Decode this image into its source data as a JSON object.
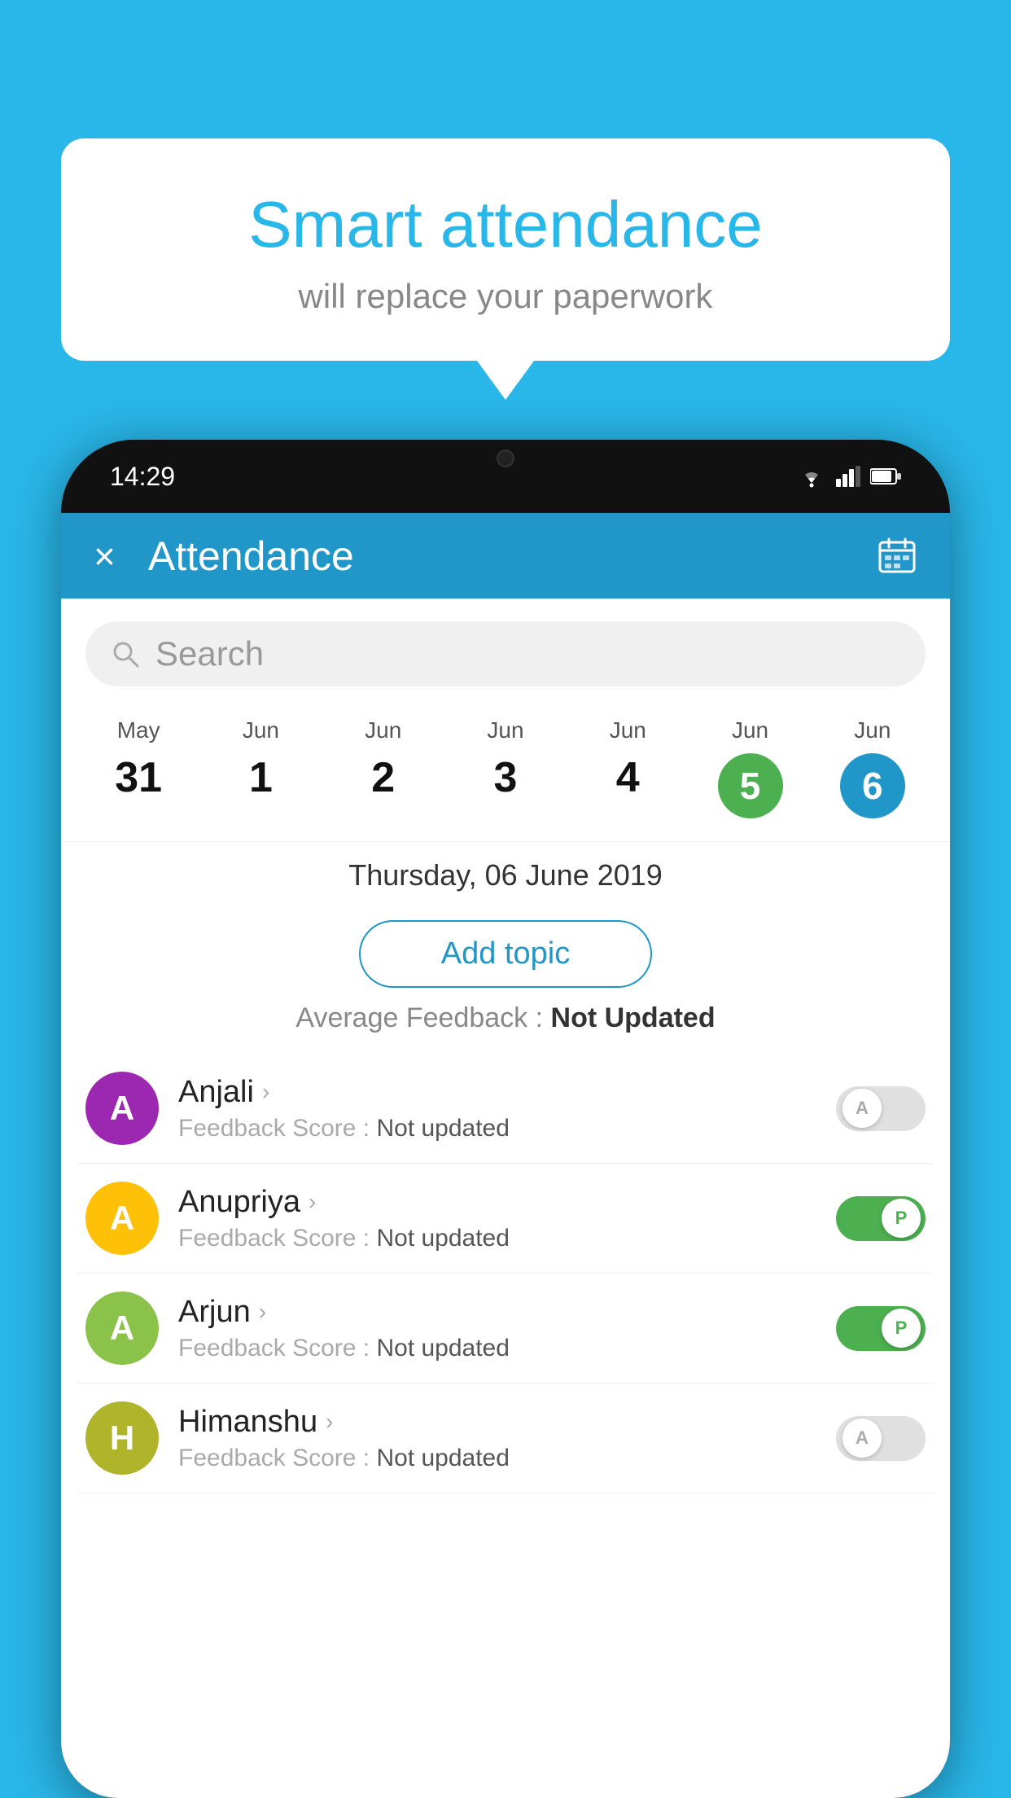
{
  "background": {
    "color": "#29b6e8"
  },
  "speech_bubble": {
    "title": "Smart attendance",
    "subtitle": "will replace your paperwork"
  },
  "phone": {
    "status_bar": {
      "time": "14:29",
      "icons": [
        "wifi",
        "signal",
        "battery"
      ]
    },
    "header": {
      "title": "Attendance",
      "close_label": "×",
      "calendar_icon": "📅"
    },
    "search": {
      "placeholder": "Search"
    },
    "dates": [
      {
        "month": "May",
        "number": "31",
        "state": "normal"
      },
      {
        "month": "Jun",
        "number": "1",
        "state": "normal"
      },
      {
        "month": "Jun",
        "number": "2",
        "state": "normal"
      },
      {
        "month": "Jun",
        "number": "3",
        "state": "normal"
      },
      {
        "month": "Jun",
        "number": "4",
        "state": "normal"
      },
      {
        "month": "Jun",
        "number": "5",
        "state": "active-green"
      },
      {
        "month": "Jun",
        "number": "6",
        "state": "active-blue"
      }
    ],
    "selected_date": "Thursday, 06 June 2019",
    "add_topic_label": "Add topic",
    "avg_feedback_label": "Average Feedback :",
    "avg_feedback_value": "Not Updated",
    "students": [
      {
        "name": "Anjali",
        "avatar_letter": "A",
        "avatar_color": "avatar-purple",
        "feedback_label": "Feedback Score :",
        "feedback_value": "Not updated",
        "toggle": "off",
        "toggle_letter": "A"
      },
      {
        "name": "Anupriya",
        "avatar_letter": "A",
        "avatar_color": "avatar-yellow",
        "feedback_label": "Feedback Score :",
        "feedback_value": "Not updated",
        "toggle": "on",
        "toggle_letter": "P"
      },
      {
        "name": "Arjun",
        "avatar_letter": "A",
        "avatar_color": "avatar-light-green",
        "feedback_label": "Feedback Score :",
        "feedback_value": "Not updated",
        "toggle": "on",
        "toggle_letter": "P"
      },
      {
        "name": "Himanshu",
        "avatar_letter": "H",
        "avatar_color": "avatar-olive",
        "feedback_label": "Feedback Score :",
        "feedback_value": "Not updated",
        "toggle": "off",
        "toggle_letter": "A"
      }
    ]
  }
}
